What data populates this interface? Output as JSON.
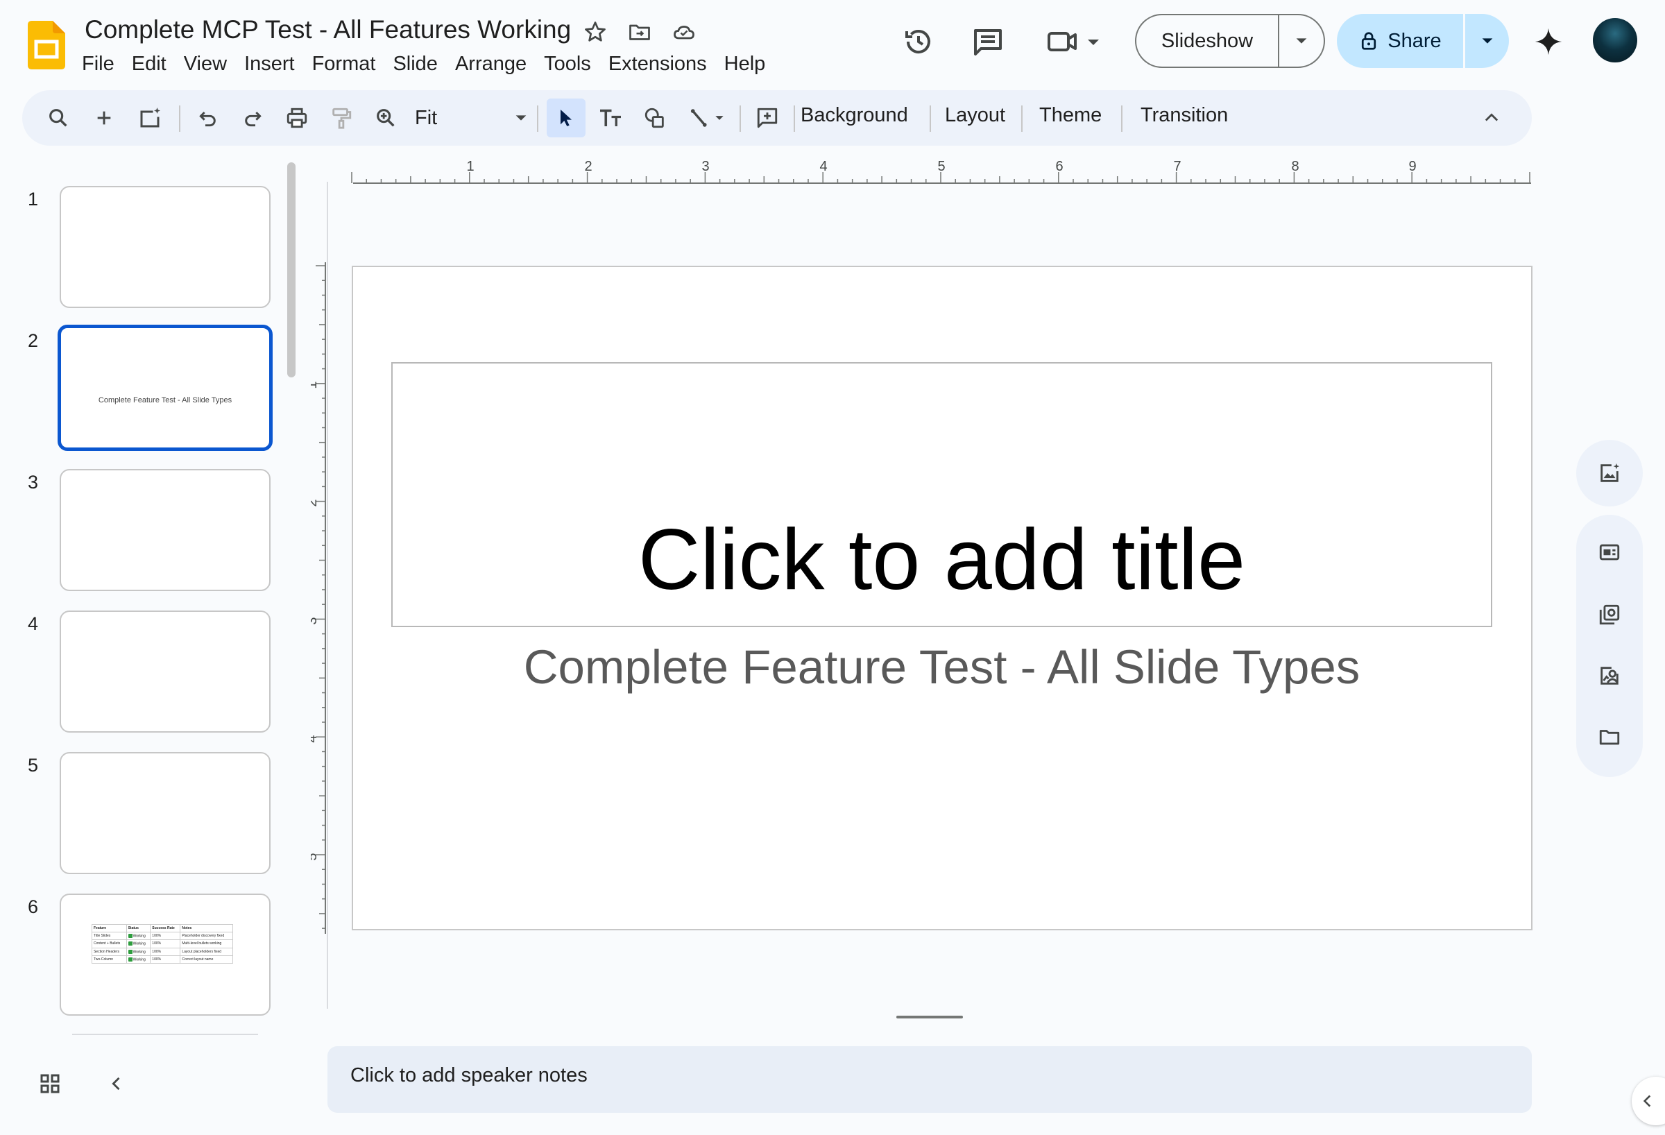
{
  "app": {
    "doc_title": "Complete MCP Test - All Features Working",
    "menu": [
      "File",
      "Edit",
      "View",
      "Insert",
      "Format",
      "Slide",
      "Arrange",
      "Tools",
      "Extensions",
      "Help"
    ],
    "slideshow_label": "Slideshow",
    "share_label": "Share",
    "brand_color": "#fbbc04",
    "accent_color": "#0b57d0",
    "share_bg": "#c2e7ff"
  },
  "toolbar": {
    "zoom_value": "Fit",
    "background_label": "Background",
    "layout_label": "Layout",
    "theme_label": "Theme",
    "transition_label": "Transition",
    "icons": [
      "search-icon",
      "add-slide-icon",
      "new-slide-with-layout-icon",
      "undo-icon",
      "redo-icon",
      "print-icon",
      "paint-format-icon",
      "zoom-icon",
      "select-cursor-icon",
      "text-box-icon",
      "shape-icon",
      "line-icon",
      "comment-add-icon",
      "collapse-toolbar-icon"
    ]
  },
  "filmstrip": {
    "selected": 2,
    "slides": [
      {
        "number": "1",
        "subtitle": ""
      },
      {
        "number": "2",
        "subtitle": "Complete Feature Test - All Slide Types"
      },
      {
        "number": "3",
        "subtitle": ""
      },
      {
        "number": "4",
        "subtitle": ""
      },
      {
        "number": "5",
        "subtitle": ""
      },
      {
        "number": "6",
        "subtitle": ""
      }
    ],
    "slide6_table": {
      "headers": [
        "Feature",
        "Status",
        "Success Rate",
        "Notes"
      ],
      "rows": [
        [
          "Title Slides",
          "Working",
          "100%",
          "Placeholder discovery fixed"
        ],
        [
          "Content + Bullets",
          "Working",
          "100%",
          "Multi-level bullets working"
        ],
        [
          "Section Headers",
          "Working",
          "100%",
          "Layout placeholders fixed"
        ],
        [
          "Two-Column",
          "Working",
          "100%",
          "Correct layout name"
        ]
      ]
    }
  },
  "ruler": {
    "horizontal": [
      "1",
      "2",
      "3",
      "4",
      "5",
      "6",
      "7",
      "8",
      "9"
    ],
    "vertical": [
      "1",
      "2",
      "3",
      "4",
      "5"
    ]
  },
  "slide": {
    "title_placeholder": "Click to add title",
    "subtitle": "Complete Feature Test - All Slide Types"
  },
  "notes": {
    "placeholder": "Click to add speaker notes"
  },
  "side_panel": {
    "icons": [
      "generate-image-icon",
      "keep-notes-icon",
      "tasks-icon",
      "contacts-icon",
      "folder-icon"
    ]
  }
}
